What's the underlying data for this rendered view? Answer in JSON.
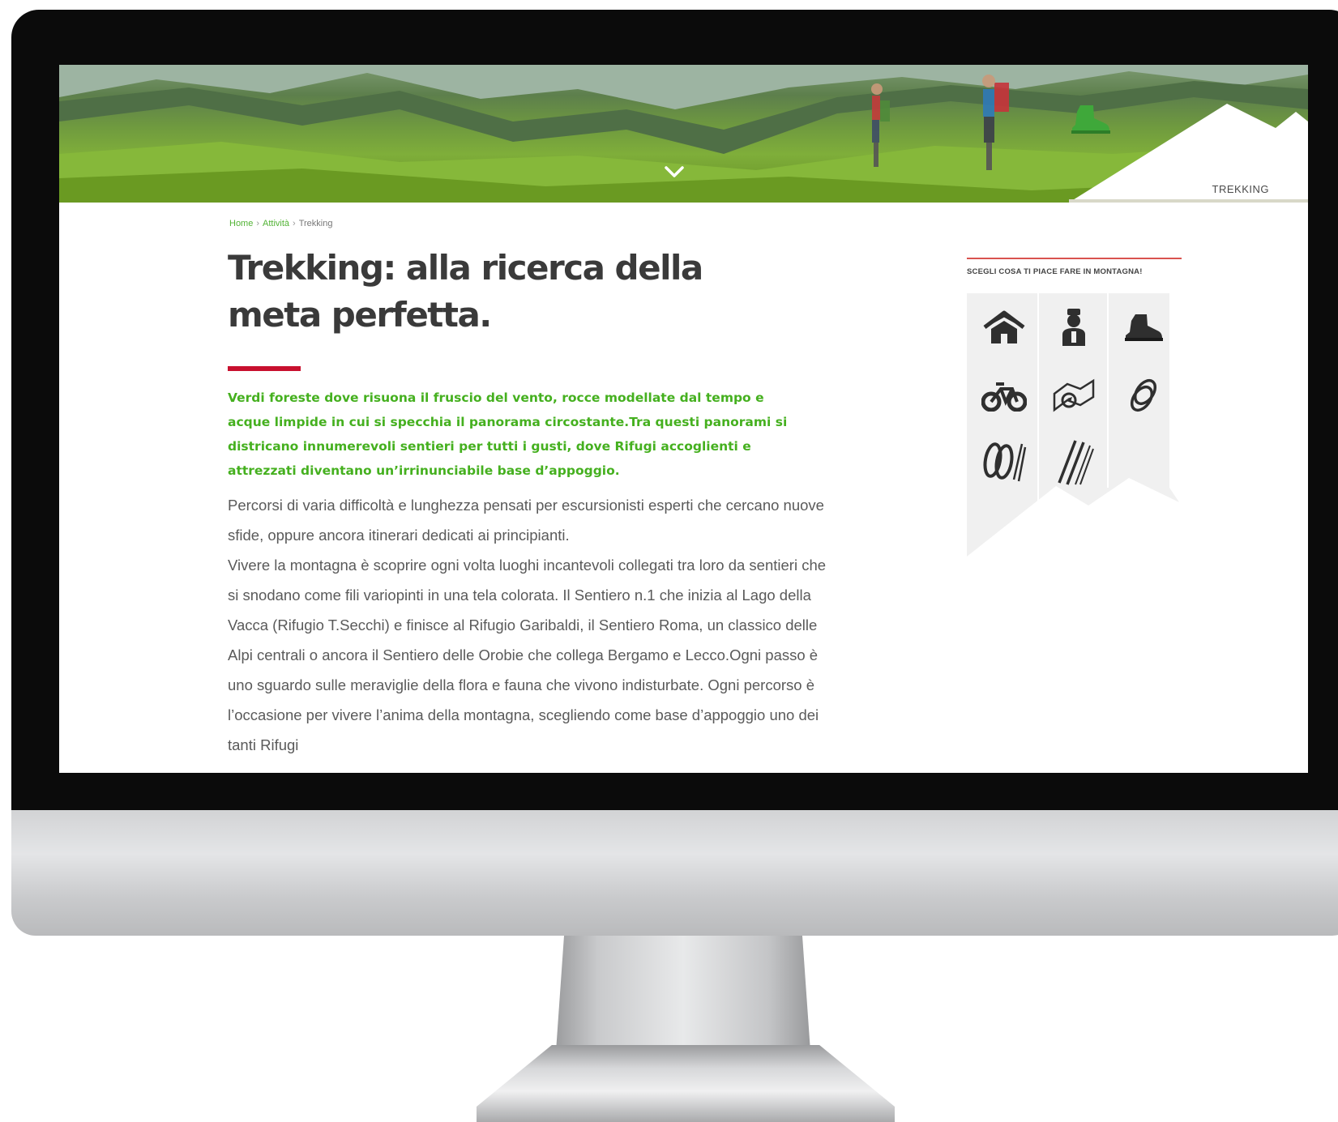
{
  "hero": {
    "badge_label": "TREKKING"
  },
  "breadcrumb": {
    "items": [
      "Home",
      "Attività",
      "Trekking"
    ],
    "separator": "›"
  },
  "article": {
    "title_line1": "Trekking: alla ricerca della",
    "title_line2": "meta perfetta.",
    "lead": "Verdi foreste dove risuona il fruscio del vento, rocce modellate dal tempo e acque limpide in cui si specchia il panorama circostante.Tra questi panorami si districano innumerevoli sentieri per tutti i gusti, dove Rifugi accoglienti e attrezzati diventano un’irrinunciabile base d’appoggio.",
    "body_p1": "Percorsi di varia difficoltà e lunghezza pensati per escursionisti esperti che cercano nuove sfide, oppure ancora itinerari dedicati ai principianti.",
    "body_p2": "Vivere la montagna è scoprire ogni volta luoghi incantevoli collegati tra loro da sentieri che si snodano come fili variopinti in una tela colorata. Il Sentiero n.1 che inizia al Lago della Vacca (Rifugio T.Secchi) e finisce al Rifugio Garibaldi, il Sentiero Roma, un classico delle Alpi centrali o ancora il Sentiero delle Orobie che collega Bergamo e Lecco.Ogni passo è uno sguardo sulle meraviglie della flora e fauna che vivono indisturbate. Ogni percorso è l’occasione per vivere l’anima della montagna, scegliendo come base d’appoggio uno dei tanti Rifugi"
  },
  "sidebar": {
    "heading": "SCEGLI COSA TI PIACE FARE IN MONTAGNA!",
    "activities": [
      {
        "icon": "refuge-house-icon"
      },
      {
        "icon": "chef-icon"
      },
      {
        "icon": "hiking-boot-icon"
      },
      {
        "icon": "mountain-bike-icon"
      },
      {
        "icon": "map-compass-icon"
      },
      {
        "icon": "climbing-rope-icon"
      },
      {
        "icon": "snowshoes-icon"
      },
      {
        "icon": "ski-poles-icon"
      }
    ]
  },
  "colors": {
    "accent_green": "#45b01f",
    "accent_red": "#c8102e",
    "title_gray": "#3a3a3a",
    "body_gray": "#5a5a5a"
  }
}
